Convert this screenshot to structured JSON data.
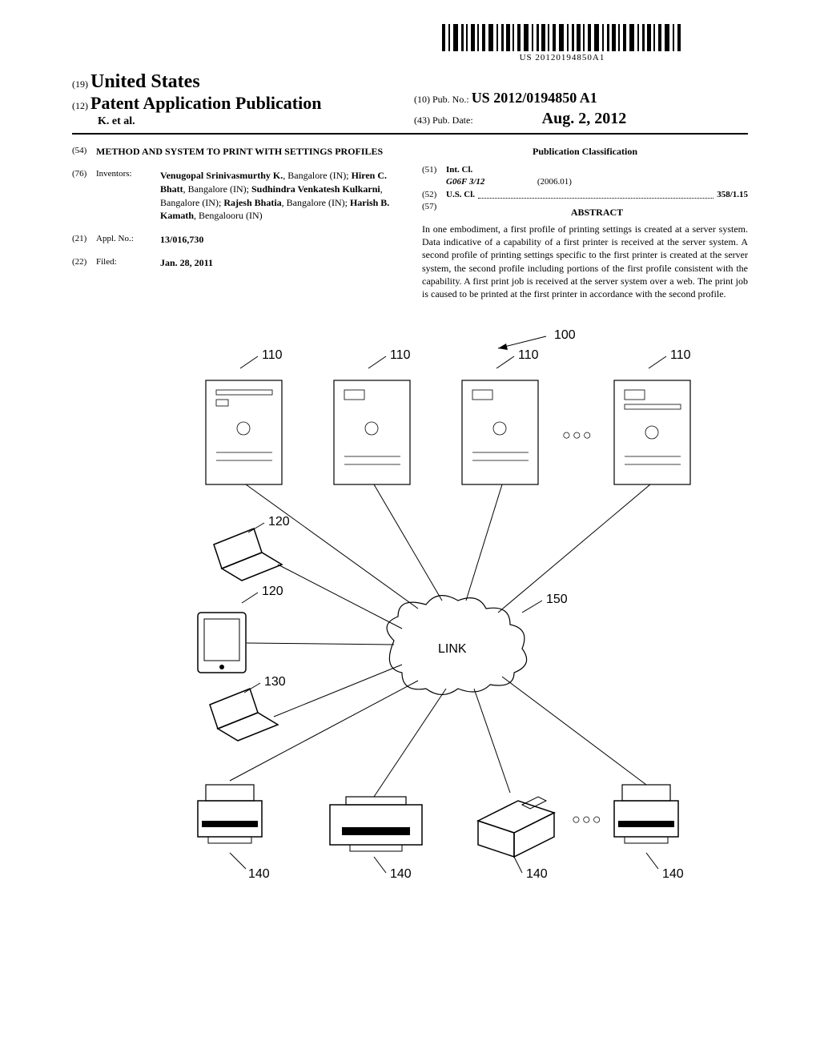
{
  "barcode_number": "US 20120194850A1",
  "header": {
    "code19": "(19)",
    "country": "United States",
    "code12": "(12)",
    "pub_type": "Patent Application Publication",
    "authors_line": "K. et al.",
    "code10": "(10)",
    "pub_no_label": "Pub. No.:",
    "pub_no": "US 2012/0194850 A1",
    "code43": "(43)",
    "pub_date_label": "Pub. Date:",
    "pub_date": "Aug. 2, 2012"
  },
  "fields": {
    "title_code": "(54)",
    "title": "METHOD AND SYSTEM TO PRINT WITH SETTINGS PROFILES",
    "inventors_code": "(76)",
    "inventors_label": "Inventors:",
    "inventors_html": "<b>Venugopal Srinivasmurthy K.</b>, Bangalore (IN); <b>Hiren C. Bhatt</b>, Bangalore (IN); <b>Sudhindra Venkatesh Kulkarni</b>, Bangalore (IN); <b>Rajesh Bhatia</b>, Bangalore (IN); <b>Harish B. Kamath</b>, Bengalooru (IN)",
    "appl_code": "(21)",
    "appl_label": "Appl. No.:",
    "appl_no": "13/016,730",
    "filed_code": "(22)",
    "filed_label": "Filed:",
    "filed_date": "Jan. 28, 2011"
  },
  "classification": {
    "heading": "Publication Classification",
    "intcl_code": "(51)",
    "intcl_label": "Int. Cl.",
    "intcl_class": "G06F 3/12",
    "intcl_year": "(2006.01)",
    "uscl_code": "(52)",
    "uscl_label": "U.S. Cl.",
    "uscl_value": "358/1.15"
  },
  "abstract": {
    "code": "(57)",
    "heading": "ABSTRACT",
    "text": "In one embodiment, a first profile of printing settings is created at a server system. Data indicative of a capability of a first printer is received at the server system. A second profile of printing settings specific to the first printer is created at the server system, the second profile including portions of the first profile consistent with the capability. A first print job is received at the server system over a web. The print job is caused to be printed at the first printer in accordance with the second profile."
  },
  "figure": {
    "ref_100": "100",
    "ref_110": "110",
    "ref_120": "120",
    "ref_130": "130",
    "ref_140": "140",
    "ref_150": "150",
    "link_label": "LINK",
    "ellipsis": "○○○"
  }
}
